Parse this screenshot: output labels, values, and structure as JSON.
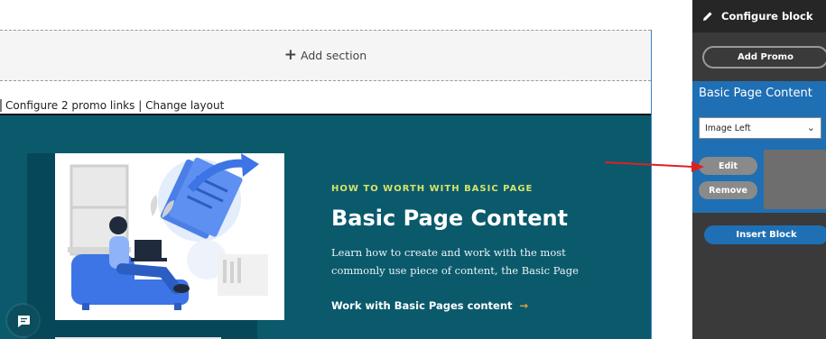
{
  "canvas": {
    "add_section": {
      "icon": "plus-icon",
      "label": "Add section"
    },
    "layout_links": {
      "configure": "Configure 2 promo links",
      "separator": "|",
      "change": "Change layout"
    }
  },
  "promo": {
    "background": "#0a5a6c",
    "eyebrow": "HOW TO WORTH WITH BASIC PAGE",
    "heading": "Basic Page Content",
    "body": "Learn how to create and work with the most commonly use piece of content, the Basic Page",
    "cta": {
      "label": "Work with Basic Pages content",
      "icon": "arrow-right-icon"
    },
    "image": "illustration-person-laptop-documents"
  },
  "chat": {
    "icon": "chat-icon"
  },
  "sidebar": {
    "header": {
      "icon": "pencil-icon",
      "title": "Configure block"
    },
    "add_promo_label": "Add Promo",
    "card": {
      "title": "Basic Page Content",
      "select_value": "Image Left",
      "edit_label": "Edit",
      "remove_label": "Remove"
    },
    "insert_block_label": "Insert Block"
  },
  "colors": {
    "accent_blue": "#1f6fb4",
    "promo_teal": "#0a5a6c",
    "eyebrow_yellow": "#d9e26a",
    "annotation_red": "#e02020"
  }
}
